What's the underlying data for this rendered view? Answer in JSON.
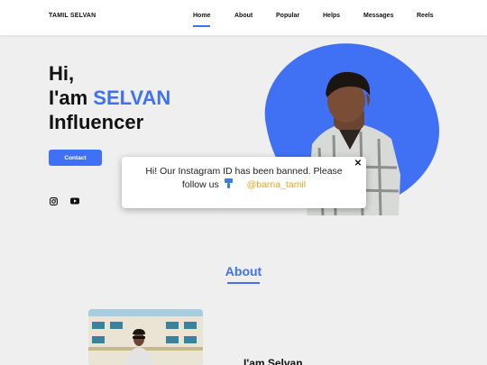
{
  "header": {
    "brand": "TAMIL SELVAN",
    "nav": [
      {
        "label": "Home",
        "active": true
      },
      {
        "label": "About"
      },
      {
        "label": "Popular"
      },
      {
        "label": "Helps"
      },
      {
        "label": "Messages"
      },
      {
        "label": "Reels"
      }
    ]
  },
  "hero": {
    "line1": "Hi,",
    "line2_prefix": "I'am ",
    "line2_name": "SELVAN",
    "line3": "Influencer",
    "contact_label": "Contact",
    "socials": [
      "instagram-icon",
      "youtube-icon"
    ],
    "accent_color": "#4070f4"
  },
  "popup": {
    "message": "Hi! Our Instagram ID has been banned. Please follow us",
    "icon": "pointing-down-icon",
    "handle": "@barna_tamil",
    "close": "✕"
  },
  "about": {
    "title": "About",
    "heading": "I'am Selvan"
  }
}
